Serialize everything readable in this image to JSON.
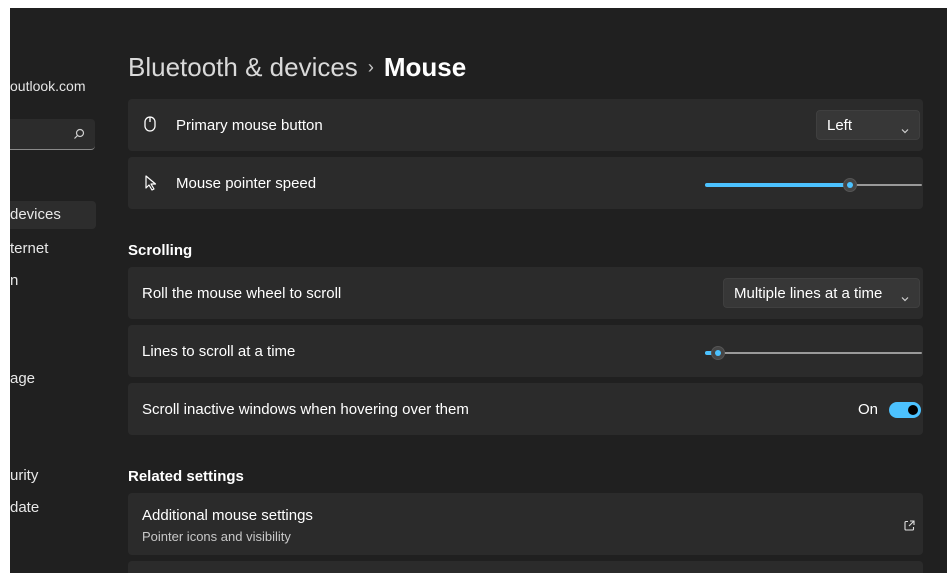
{
  "sidebar": {
    "account_email": "outlook.com",
    "search_placeholder": "",
    "items": [
      {
        "label": "devices",
        "active": true
      },
      {
        "label": "ternet"
      },
      {
        "label": "n"
      },
      {
        "label": "age"
      },
      {
        "label": "urity"
      },
      {
        "label": "date"
      }
    ]
  },
  "breadcrumb": {
    "parent": "Bluetooth & devices",
    "separator": "›",
    "current": "Mouse"
  },
  "settings": {
    "primary_button": {
      "label": "Primary mouse button",
      "value": "Left",
      "icon": "mouse-icon"
    },
    "pointer_speed": {
      "label": "Mouse pointer speed",
      "level": 0.67,
      "icon": "pointer-icon"
    }
  },
  "scrolling": {
    "title": "Scrolling",
    "wheel": {
      "label": "Roll the mouse wheel to scroll",
      "value": "Multiple lines at a time"
    },
    "lines": {
      "label": "Lines to scroll at a time",
      "level": 0.06
    },
    "inactive": {
      "label": "Scroll inactive windows when hovering over them",
      "state": "On"
    }
  },
  "related": {
    "title": "Related settings",
    "additional": {
      "label": "Additional mouse settings",
      "sublabel": "Pointer icons and visibility",
      "icon": "open-external-icon"
    }
  },
  "colors": {
    "accent": "#4cc2ff",
    "background": "#202020",
    "card": "#2b2b2b"
  }
}
